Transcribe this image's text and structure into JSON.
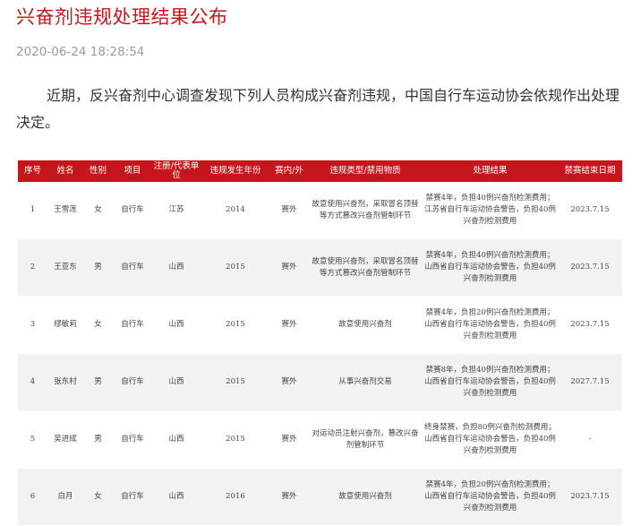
{
  "article": {
    "title": "兴奋剂违规处理结果公布",
    "datetime": "2020-06-24 18:28:54",
    "intro": "近期，反兴奋剂中心调查发现下列人员构成兴奋剂违规，中国自行车运动协会依规作出处理决定。"
  },
  "table": {
    "headers": [
      "序号",
      "姓名",
      "性别",
      "项目",
      "注册/代表单位",
      "违规发生年份",
      "赛内/外",
      "违规类型/禁用物质",
      "处理结果",
      "禁赛结束日期"
    ],
    "rows": [
      [
        "1",
        "王雪莲",
        "女",
        "自行车",
        "江苏",
        "2014",
        "赛外",
        "故意使用兴奋剂，采取冒名顶替等方式篡改兴奋剂管制环节",
        "禁赛4年，负担40例兴奋剂检测费用；江苏省自行车运动协会警告，负担40例兴奋剂检测费用",
        "2023.7.15"
      ],
      [
        "2",
        "王亚东",
        "男",
        "自行车",
        "山西",
        "2015",
        "赛外",
        "故意使用兴奋剂，采取冒名顶替等方式篡改兴奋剂管制环节",
        "禁赛4年，负担40例兴奋剂检测费用；山西省自行车运动协会警告，负担40例兴奋剂检测费用",
        "2023.7.15"
      ],
      [
        "3",
        "缪敏莉",
        "女",
        "自行车",
        "山西",
        "2015",
        "赛外",
        "故意使用兴奋剂",
        "禁赛4年，负担20例兴奋剂检测费用；山西省自行车运动协会警告，负担40例兴奋剂检测费用",
        "2023.7.15"
      ],
      [
        "4",
        "张东村",
        "男",
        "自行车",
        "山西",
        "2015",
        "赛外",
        "从事兴奋剂交易",
        "禁赛8年，负担40例兴奋剂检测费用；山西省自行车运动协会警告，负担40例兴奋剂检测费用",
        "2027.7.15"
      ],
      [
        "5",
        "吴进成",
        "男",
        "自行车",
        "山西",
        "2015",
        "赛外",
        "对运动员注射兴奋剂，篡改兴奋剂管制环节",
        "终身禁赛，负担80例兴奋剂检测费用；山西省自行车运动协会警告，负担40例兴奋剂检测费用",
        "-"
      ],
      [
        "6",
        "白月",
        "女",
        "自行车",
        "山西",
        "2016",
        "赛外",
        "故意使用兴奋剂",
        "禁赛4年，负担20例兴奋剂检测费用；山西省自行车运动协会警告，负担40例兴奋剂检测费用",
        "2023.7.15"
      ]
    ]
  },
  "colors": {
    "accent": "#c4161c",
    "row_alt": "#f2f2f2",
    "meta_text": "#9a9a9a"
  }
}
